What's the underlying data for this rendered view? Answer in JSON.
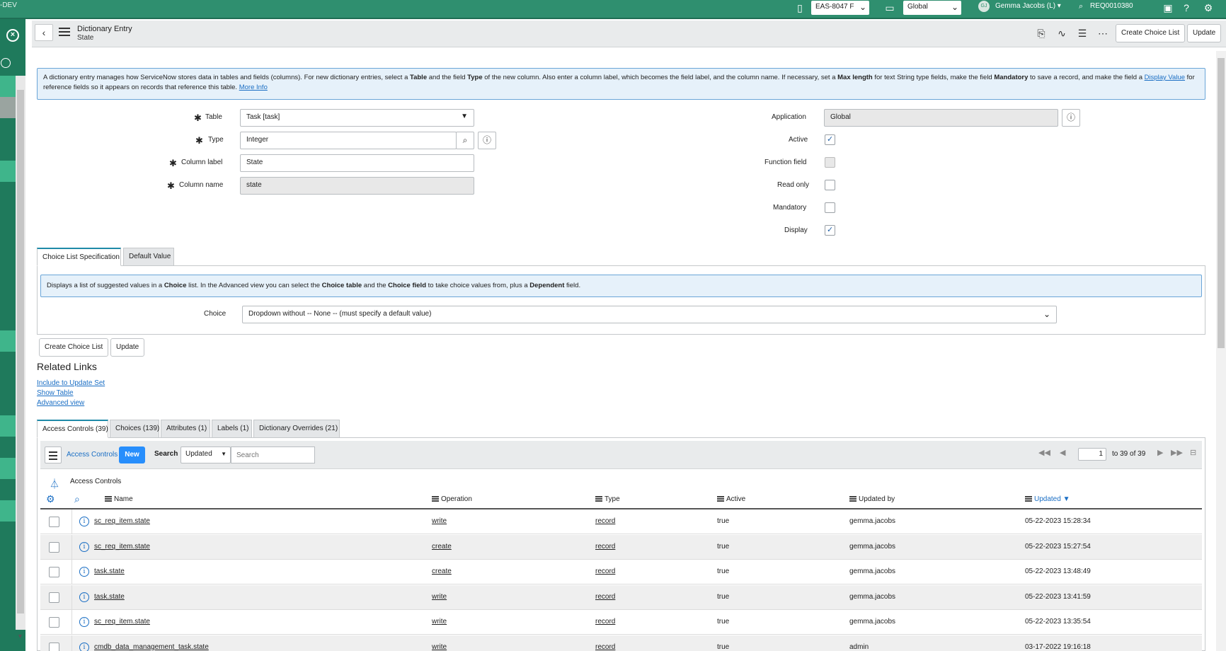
{
  "topbar": {
    "env_tag": "-DEV",
    "update_set": "EAS-8047 F",
    "scope": "Global",
    "user_initials": "GJ",
    "user_name": "Gemma Jacobs (L)",
    "search_value": "REQ0010380"
  },
  "form_header": {
    "title": "Dictionary Entry",
    "subtitle": "State",
    "create_choice_list": "Create Choice List",
    "update": "Update"
  },
  "intro": {
    "p1": "A dictionary entry manages how ServiceNow stores data in tables and fields (columns). For new dictionary entries, select a ",
    "b1": "Table",
    "p2": " and the field ",
    "b2": "Type",
    "p3": " of the new column. Also enter a column label, which becomes the field label, and the column name. If necessary, set a ",
    "b3": "Max length",
    "p4": " for text String type fields, make the field ",
    "b4": "Mandatory",
    "p5": " to save a record, and make the field a ",
    "link1": "Display Value",
    "p6": " for reference fields so it appears on records that reference this table. ",
    "link2": "More Info"
  },
  "fields": {
    "table_label": "Table",
    "table_value": "Task [task]",
    "type_label": "Type",
    "type_value": "Integer",
    "column_label_label": "Column label",
    "column_label_value": "State",
    "column_name_label": "Column name",
    "column_name_value": "state",
    "application_label": "Application",
    "application_value": "Global",
    "active_label": "Active",
    "function_field_label": "Function field",
    "read_only_label": "Read only",
    "mandatory_label": "Mandatory",
    "display_label": "Display"
  },
  "checkboxes": {
    "active": true,
    "function_field": false,
    "read_only": false,
    "mandatory": false,
    "display": true
  },
  "section_tabs": [
    "Choice List Specification",
    "Default Value"
  ],
  "choice_info": {
    "p1": "Displays a list of suggested values in a ",
    "b1": "Choice",
    "p2": " list. In the Advanced view you can select the ",
    "b2": "Choice table",
    "p3": " and the ",
    "b3": "Choice field",
    "p4": " to take choice values from, plus a ",
    "b4": "Dependent",
    "p5": " field."
  },
  "choice": {
    "label": "Choice",
    "value": "Dropdown without -- None -- (must specify a default value)"
  },
  "bottom_buttons": {
    "create_choice_list": "Create Choice List",
    "update": "Update"
  },
  "related_links": {
    "heading": "Related Links",
    "links": [
      "Include to Update Set",
      "Show Table",
      "Advanced view"
    ]
  },
  "related_tabs": [
    "Access Controls (39)",
    "Choices (139)",
    "Attributes (1)",
    "Labels (1)",
    "Dictionary Overrides (21)"
  ],
  "list": {
    "title": "Access Controls",
    "new": "New",
    "search_label": "Search",
    "search_field": "Updated",
    "search_placeholder": "Search",
    "page": "1",
    "range": "to 39 of 39",
    "breadcrumb": "Access Controls",
    "columns": [
      "Name",
      "Operation",
      "Type",
      "Active",
      "Updated by",
      "Updated"
    ],
    "sort_color": "#1a6ec4",
    "rows": [
      [
        "sc_req_item.state",
        "write",
        "record",
        "true",
        "gemma.jacobs",
        "05-22-2023 15:28:34"
      ],
      [
        "sc_req_item.state",
        "create",
        "record",
        "true",
        "gemma.jacobs",
        "05-22-2023 15:27:54"
      ],
      [
        "task.state",
        "create",
        "record",
        "true",
        "gemma.jacobs",
        "05-22-2023 13:48:49"
      ],
      [
        "task.state",
        "write",
        "record",
        "true",
        "gemma.jacobs",
        "05-22-2023 13:41:59"
      ],
      [
        "sc_req_item.state",
        "write",
        "record",
        "true",
        "gemma.jacobs",
        "05-22-2023 13:35:54"
      ],
      [
        "cmdb_data_management_task.state",
        "write",
        "record",
        "true",
        "admin",
        "03-17-2022 19:16:18"
      ]
    ]
  },
  "colors": {
    "banner": "#2f8f6f",
    "accent_blue": "#278efc"
  }
}
